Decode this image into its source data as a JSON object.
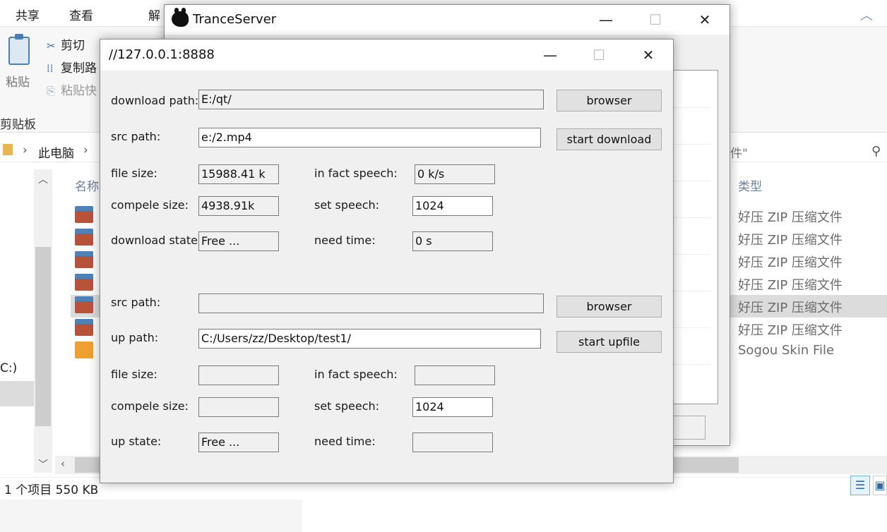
{
  "explorer": {
    "ribbon_tabs": [
      "共享",
      "查看",
      "解"
    ],
    "clipboard": {
      "paste_label": "粘贴",
      "cut_label": "剪切",
      "copy_path_label": "复制路",
      "paste_shortcut_label": "粘贴快",
      "group_label": "剪贴板"
    },
    "address": {
      "crumb1": "此电脑",
      "sep": "›",
      "search_suffix": "件\""
    },
    "columns": {
      "name": "名称",
      "type": "类型"
    },
    "drive_label": "C:)",
    "file_types": [
      "好压 ZIP 压缩文件",
      "好压 ZIP 压缩文件",
      "好压 ZIP 压缩文件",
      "好压 ZIP 压缩文件",
      "好压 ZIP 压缩文件",
      "好压 ZIP 压缩文件",
      "Sogou Skin File"
    ],
    "status": "1 个项目   550 KB",
    "icons": {
      "collapse": "chevron-up-icon",
      "search": "search-icon",
      "details_view": "details-view-icon",
      "large_view": "large-icons-view-icon"
    }
  },
  "trance_window": {
    "title": "TranceServer",
    "controls": {
      "minimize": "—",
      "maximize": "☐",
      "close": "✕"
    }
  },
  "main_window": {
    "title": "//127.0.0.1:8888",
    "controls": {
      "minimize": "—",
      "maximize": "☐",
      "close": "✕"
    },
    "download": {
      "download_path_label": "download path:",
      "download_path_value": "E:/qt/",
      "browser_button": "browser",
      "src_path_label": "src path:",
      "src_path_value": "e:/2.mp4",
      "start_download_button": "start download",
      "file_size_label": "file size:",
      "file_size_value": "15988.41 k",
      "in_fact_speech_label": "in fact speech:",
      "in_fact_speech_value": "0 k/s",
      "compele_size_label": "compele size:",
      "compele_size_value": "4938.91k",
      "set_speech_label": "set speech:",
      "set_speech_value": "1024",
      "state_label": "download state:",
      "state_value": "Free ...",
      "need_time_label": "need time:",
      "need_time_value": "0 s"
    },
    "upload": {
      "src_path_label": "src path:",
      "src_path_value": "",
      "browser_button": "browser",
      "up_path_label": "up path:",
      "up_path_value": "C:/Users/zz/Desktop/test1/",
      "start_upfile_button": "start upfile",
      "file_size_label": "file size:",
      "file_size_value": "",
      "in_fact_speech_label": "in fact speech:",
      "in_fact_speech_value": "",
      "compele_size_label": "compele size:",
      "compele_size_value": "",
      "set_speech_label": "set speech:",
      "set_speech_value": "1024",
      "state_label": "up state:",
      "state_value": "Free ...",
      "need_time_label": "need time:",
      "need_time_value": ""
    }
  }
}
